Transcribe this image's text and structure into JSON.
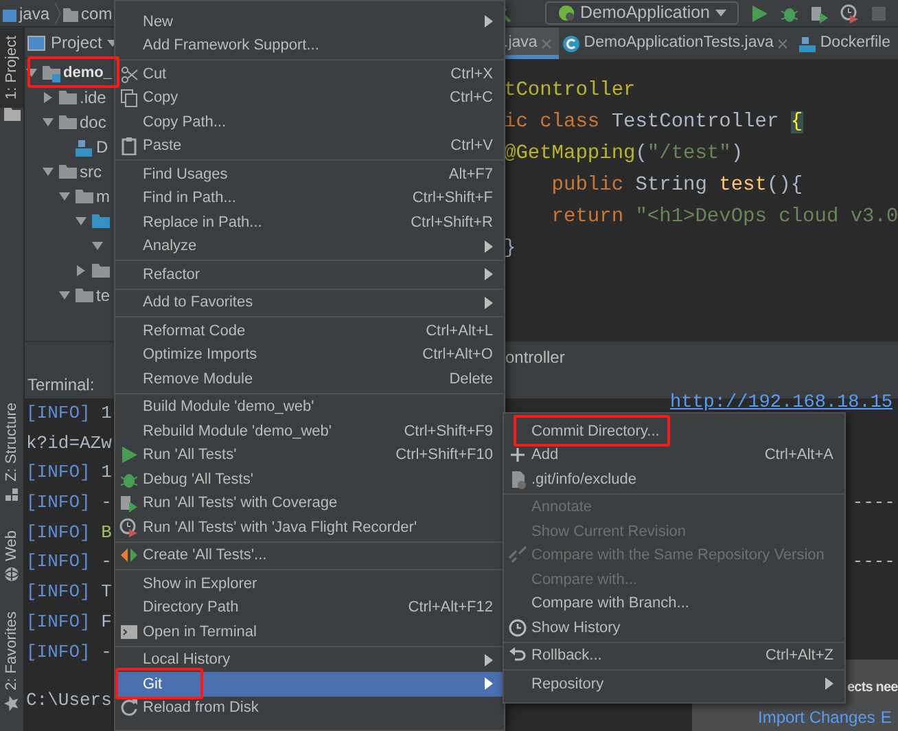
{
  "breadcrumbs": [
    {
      "label": "java"
    },
    {
      "label": "com"
    }
  ],
  "toolbar": {
    "run_config": "DemoApplication"
  },
  "side_tabs_top": [
    {
      "label": "1: Project",
      "selected": true
    }
  ],
  "side_tabs_bottom": [
    {
      "label": "Z: Structure",
      "selected": false
    },
    {
      "label": "Web",
      "selected": false
    },
    {
      "label": "2: Favorites",
      "selected": false
    }
  ],
  "project": {
    "title": "Project",
    "tree": [
      {
        "label": "demo_",
        "expanded": true,
        "annotated": true,
        "children": [
          {
            "label": ".ide",
            "expanded": false
          },
          {
            "label": "doc",
            "expanded": true,
            "children": [
              {
                "label": "D"
              }
            ]
          },
          {
            "label": "src",
            "expanded": true,
            "children": [
              {
                "label": "m",
                "expanded": true,
                "children": [
                  {
                    "expanded": true,
                    "children": [
                      {
                        "expanded": true
                      }
                    ]
                  },
                  {
                    "expanded": false
                  }
                ]
              },
              {
                "label": "te",
                "expanded": true
              }
            ]
          }
        ]
      }
    ]
  },
  "editor": {
    "tabs": [
      {
        "label": ".java",
        "selected": true
      },
      {
        "label": "DemoApplicationTests.java",
        "selected": false
      },
      {
        "label": "Dockerfile",
        "selected": false
      }
    ],
    "lines": [
      [
        {
          "text": "tController",
          "kind": "annotation"
        }
      ],
      [
        {
          "text": "ic class ",
          "kind": "keyword"
        },
        {
          "text": "TestController ",
          "kind": "plain"
        },
        {
          "text": "{",
          "kind": "brace"
        }
      ],
      [
        {
          "text": "@GetMapping",
          "kind": "annotation"
        },
        {
          "text": "(",
          "kind": "plain"
        },
        {
          "text": "\"/test\"",
          "kind": "string"
        },
        {
          "text": ")",
          "kind": "plain"
        }
      ],
      [
        {
          "text": "    public ",
          "kind": "keyword"
        },
        {
          "text": "String ",
          "kind": "plain"
        },
        {
          "text": "test",
          "kind": "method"
        },
        {
          "text": "(){",
          "kind": "plain"
        }
      ],
      [
        {
          "text": "    return ",
          "kind": "keyword"
        },
        {
          "text": "\"<h1>DevOps cloud v3.0",
          "kind": "string"
        }
      ],
      [
        {
          "text": "}",
          "kind": "plain"
        }
      ]
    ]
  },
  "run_bar": {
    "title": "ontroller"
  },
  "terminal": {
    "title": "Terminal:",
    "url": "http://192.168.18.15",
    "lines": [
      [
        {
          "text": "[INFO]",
          "kind": "info"
        },
        {
          "text": " 1",
          "kind": "plain"
        }
      ],
      [
        {
          "text": "k?id=AZw",
          "kind": "plain"
        }
      ],
      [
        {
          "text": "[INFO]",
          "kind": "info"
        },
        {
          "text": " 1",
          "kind": "plain"
        }
      ],
      [
        {
          "text": "[INFO]",
          "kind": "info"
        },
        {
          "text": " -",
          "kind": "plain"
        },
        {
          "text": "----",
          "kind": "tail"
        }
      ],
      [
        {
          "text": "[INFO]",
          "kind": "info"
        },
        {
          "text": " B",
          "kind": "warn"
        }
      ],
      [
        {
          "text": "[INFO]",
          "kind": "info"
        },
        {
          "text": " -",
          "kind": "plain"
        },
        {
          "text": "----",
          "kind": "tail"
        }
      ],
      [
        {
          "text": "[INFO]",
          "kind": "info"
        },
        {
          "text": " T",
          "kind": "plain"
        }
      ],
      [
        {
          "text": "[INFO]",
          "kind": "info"
        },
        {
          "text": " F",
          "kind": "plain"
        }
      ],
      [
        {
          "text": "[INFO]",
          "kind": "info"
        },
        {
          "text": " -",
          "kind": "plain"
        }
      ]
    ],
    "prompt": "C:\\Users"
  },
  "notification": {
    "text": "ects nee",
    "links": [
      "Import Changes",
      "E"
    ]
  },
  "context_menu": [
    {
      "kind": "item",
      "label": "New",
      "submenu": true
    },
    {
      "kind": "item",
      "label": "Add Framework Support..."
    },
    {
      "kind": "separator"
    },
    {
      "kind": "item",
      "label": "Cut",
      "shortcut": "Ctrl+X"
    },
    {
      "kind": "item",
      "label": "Copy",
      "shortcut": "Ctrl+C"
    },
    {
      "kind": "item",
      "label": "Copy Path..."
    },
    {
      "kind": "item",
      "label": "Paste",
      "shortcut": "Ctrl+V"
    },
    {
      "kind": "separator"
    },
    {
      "kind": "item",
      "label": "Find Usages",
      "shortcut": "Alt+F7"
    },
    {
      "kind": "item",
      "label": "Find in Path...",
      "shortcut": "Ctrl+Shift+F"
    },
    {
      "kind": "item",
      "label": "Replace in Path...",
      "shortcut": "Ctrl+Shift+R"
    },
    {
      "kind": "item",
      "label": "Analyze",
      "submenu": true
    },
    {
      "kind": "separator"
    },
    {
      "kind": "item",
      "label": "Refactor",
      "submenu": true
    },
    {
      "kind": "separator"
    },
    {
      "kind": "item",
      "label": "Add to Favorites",
      "submenu": true
    },
    {
      "kind": "separator"
    },
    {
      "kind": "item",
      "label": "Reformat Code",
      "shortcut": "Ctrl+Alt+L"
    },
    {
      "kind": "item",
      "label": "Optimize Imports",
      "shortcut": "Ctrl+Alt+O"
    },
    {
      "kind": "item",
      "label": "Remove Module",
      "shortcut": "Delete"
    },
    {
      "kind": "separator"
    },
    {
      "kind": "item",
      "label": "Build Module 'demo_web'"
    },
    {
      "kind": "item",
      "label": "Rebuild Module 'demo_web'",
      "shortcut": "Ctrl+Shift+F9"
    },
    {
      "kind": "item",
      "label": "Run 'All Tests'",
      "shortcut": "Ctrl+Shift+F10"
    },
    {
      "kind": "item",
      "label": "Debug 'All Tests'"
    },
    {
      "kind": "item",
      "label": "Run 'All Tests' with Coverage"
    },
    {
      "kind": "item",
      "label": "Run 'All Tests' with 'Java Flight Recorder'"
    },
    {
      "kind": "separator"
    },
    {
      "kind": "item",
      "label": "Create 'All Tests'..."
    },
    {
      "kind": "separator"
    },
    {
      "kind": "item",
      "label": "Show in Explorer"
    },
    {
      "kind": "item",
      "label": "Directory Path",
      "shortcut": "Ctrl+Alt+F12"
    },
    {
      "kind": "item",
      "label": "Open in Terminal"
    },
    {
      "kind": "separator"
    },
    {
      "kind": "item",
      "label": "Local History",
      "submenu": true
    },
    {
      "kind": "item",
      "label": "Git",
      "submenu": true,
      "selected": true,
      "annotated": true
    },
    {
      "kind": "item",
      "label": "Reload from Disk"
    }
  ],
  "git_submenu": [
    {
      "kind": "item",
      "label": "Commit Directory...",
      "annotated": true
    },
    {
      "kind": "item",
      "label": "Add",
      "shortcut": "Ctrl+Alt+A"
    },
    {
      "kind": "item",
      "label": ".git/info/exclude"
    },
    {
      "kind": "separator"
    },
    {
      "kind": "item",
      "label": "Annotate",
      "disabled": true
    },
    {
      "kind": "item",
      "label": "Show Current Revision",
      "disabled": true
    },
    {
      "kind": "item",
      "label": "Compare with the Same Repository Version",
      "disabled": true
    },
    {
      "kind": "item",
      "label": "Compare with...",
      "disabled": true
    },
    {
      "kind": "item",
      "label": "Compare with Branch..."
    },
    {
      "kind": "item",
      "label": "Show History"
    },
    {
      "kind": "separator"
    },
    {
      "kind": "item",
      "label": "Rollback...",
      "shortcut": "Ctrl+Alt+Z"
    },
    {
      "kind": "separator"
    },
    {
      "kind": "item",
      "label": "Repository",
      "submenu": true
    }
  ]
}
